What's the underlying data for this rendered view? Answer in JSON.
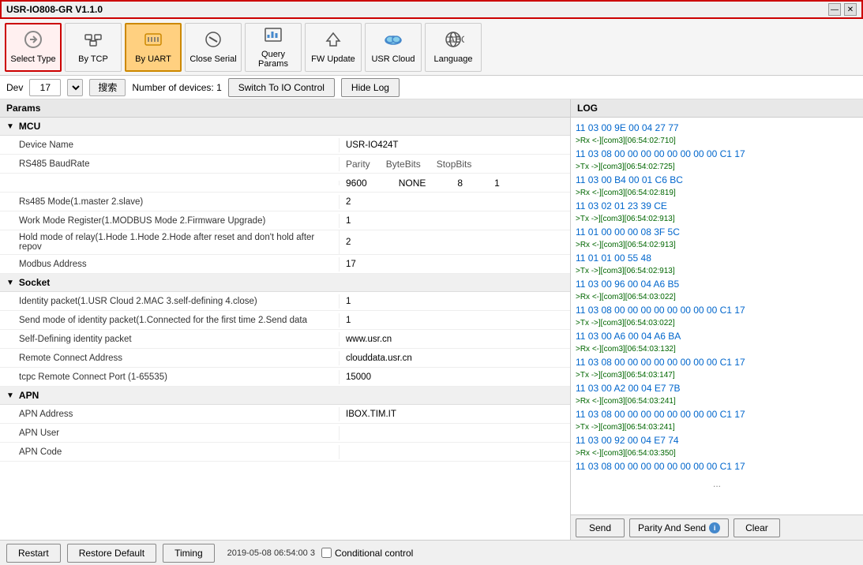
{
  "titlebar": {
    "title": "USR-IO808-GR V1.1.0",
    "minimize": "—",
    "close": "✕"
  },
  "toolbar": {
    "buttons": [
      {
        "id": "select-type",
        "label": "Select Type",
        "icon": "⬅",
        "active": false,
        "selected": true
      },
      {
        "id": "by-tcp",
        "label": "By TCP",
        "icon": "🖧",
        "active": false,
        "selected": false
      },
      {
        "id": "by-uart",
        "label": "By UART",
        "icon": "▦",
        "active": true,
        "selected": false
      },
      {
        "id": "close-serial",
        "label": "Close Serial",
        "icon": "⊕",
        "active": false,
        "selected": false
      },
      {
        "id": "query-params",
        "label": "Query Params",
        "icon": "📊",
        "active": false,
        "selected": false
      },
      {
        "id": "fw-update",
        "label": "FW Update",
        "icon": "⬆",
        "active": false,
        "selected": false
      },
      {
        "id": "usr-cloud",
        "label": "USR Cloud",
        "icon": "☁",
        "active": false,
        "selected": false
      },
      {
        "id": "language",
        "label": "Language",
        "icon": "🌐",
        "active": false,
        "selected": false
      }
    ]
  },
  "devbar": {
    "dev_label": "Dev",
    "dev_value": "17",
    "search_label": "搜索",
    "device_count": "Number of devices: 1",
    "switch_btn": "Switch To IO Control",
    "hide_btn": "Hide Log"
  },
  "params": {
    "header": "Params",
    "sections": [
      {
        "name": "MCU",
        "rows": [
          {
            "label": "Device Name",
            "values": [
              "USR-IO424T"
            ],
            "type": "single"
          },
          {
            "label": "RS485 BaudRate",
            "values": [
              "Parity",
              "ByteBits",
              "StopBits",
              "9600",
              "NONE",
              "8",
              "1"
            ],
            "type": "multi"
          },
          {
            "label": "Rs485 Mode(1.master 2.slave)",
            "values": [
              "2"
            ],
            "type": "single"
          },
          {
            "label": "Work Mode Register(1.MODBUS Mode 2.Firmware Upgrade)",
            "values": [
              "1"
            ],
            "type": "single"
          },
          {
            "label": "Hold mode of relay(1.Hode 1.Hode 2.Hode after reset and don't hold after repov",
            "values": [
              "2"
            ],
            "type": "single"
          },
          {
            "label": "Modbus Address",
            "values": [
              "17"
            ],
            "type": "single"
          }
        ]
      },
      {
        "name": "Socket",
        "rows": [
          {
            "label": "Identity packet(1.USR Cloud 2.MAC 3.self-defining 4.close)",
            "values": [
              "1"
            ],
            "type": "single"
          },
          {
            "label": "Send mode of identity packet(1.Connected for the first time 2.Send data",
            "values": [
              "1"
            ],
            "type": "single"
          },
          {
            "label": "Self-Defining identity packet",
            "values": [
              "www.usr.cn"
            ],
            "type": "single"
          },
          {
            "label": "Remote Connect Address",
            "values": [
              "clouddata.usr.cn"
            ],
            "type": "single"
          },
          {
            "label": "tcpc Remote Connect Port (1-65535)",
            "values": [
              "15000"
            ],
            "type": "single"
          }
        ]
      },
      {
        "name": "APN",
        "rows": [
          {
            "label": "APN Address",
            "values": [
              "IBOX.TIM.IT"
            ],
            "type": "single"
          },
          {
            "label": "APN User",
            "values": [
              ""
            ],
            "type": "single"
          },
          {
            "label": "APN Code",
            "values": [
              ""
            ],
            "type": "single"
          }
        ]
      }
    ]
  },
  "log": {
    "header": "LOG",
    "entries": [
      {
        "type": "rx",
        "text": "11 03 00 9E 00 04 27 77"
      },
      {
        "type": "meta",
        "text": ">Rx <-][com3][06:54:02:710]"
      },
      {
        "type": "rx",
        "text": "11 03 08 00 00 00 00 00 00 00 00 C1 17"
      },
      {
        "type": "meta",
        "text": ">Tx ->][com3][06:54:02:725]"
      },
      {
        "type": "rx",
        "text": "11 03 00 B4 00 01 C6 BC"
      },
      {
        "type": "meta",
        "text": ">Rx <-][com3][06:54:02:819]"
      },
      {
        "type": "rx",
        "text": "11 03 02 01 23 39 CE"
      },
      {
        "type": "meta",
        "text": ">Tx ->][com3][06:54:02:913]"
      },
      {
        "type": "rx",
        "text": "11 01 00 00 00 08 3F 5C"
      },
      {
        "type": "meta",
        "text": ">Rx <-][com3][06:54:02:913]"
      },
      {
        "type": "rx",
        "text": "11 01 01 00 55 48"
      },
      {
        "type": "meta",
        "text": ">Tx ->][com3][06:54:02:913]"
      },
      {
        "type": "rx",
        "text": "11 03 00 96 00 04 A6 B5"
      },
      {
        "type": "meta",
        "text": ">Rx <-][com3][06:54:03:022]"
      },
      {
        "type": "rx",
        "text": "11 03 08 00 00 00 00 00 00 00 00 C1 17"
      },
      {
        "type": "meta",
        "text": ">Tx ->][com3][06:54:03:022]"
      },
      {
        "type": "rx",
        "text": "11 03 00 A6 00 04 A6 BA"
      },
      {
        "type": "meta",
        "text": ">Rx <-][com3][06:54:03:132]"
      },
      {
        "type": "rx",
        "text": "11 03 08 00 00 00 00 00 00 00 00 C1 17"
      },
      {
        "type": "meta",
        "text": ">Tx ->][com3][06:54:03:147]"
      },
      {
        "type": "rx",
        "text": "11 03 00 A2 00 04 E7 7B"
      },
      {
        "type": "meta",
        "text": ">Rx <-][com3][06:54:03:241]"
      },
      {
        "type": "rx",
        "text": "11 03 08 00 00 00 00 00 00 00 00 C1 17"
      },
      {
        "type": "meta",
        "text": ">Tx ->][com3][06:54:03:241]"
      },
      {
        "type": "rx",
        "text": "11 03 00 92 00 04 E7 74"
      },
      {
        "type": "meta",
        "text": ">Rx <-][com3][06:54:03:350]"
      },
      {
        "type": "rx",
        "text": "11 03 08 00 00 00 00 00 00 00 00 C1 17"
      },
      {
        "type": "dots",
        "text": "..."
      }
    ]
  },
  "bottombar": {
    "restart": "Restart",
    "restore": "Restore Default",
    "timing": "Timing",
    "timestamp": "2019-05-08 06:54:00 3",
    "conditional": "Conditional control"
  },
  "log_bottom": {
    "send": "Send",
    "parity_send": "Parity And Send",
    "clear": "Clear"
  }
}
